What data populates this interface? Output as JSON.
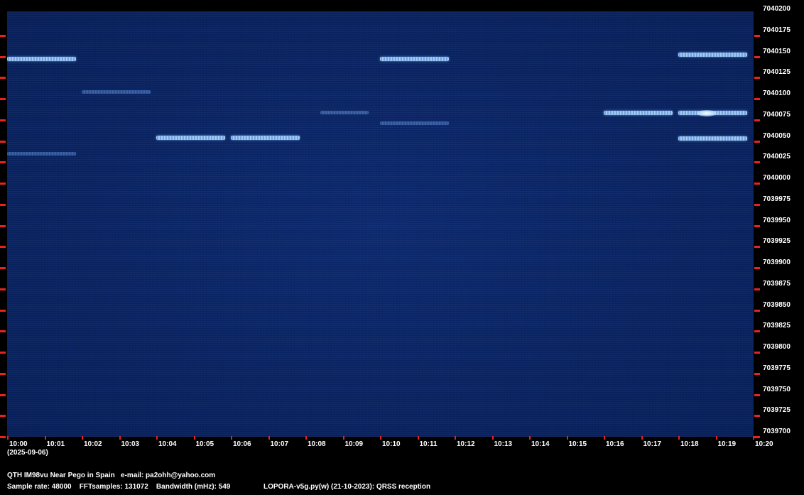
{
  "colors": {
    "background": "#000000",
    "waterfall": "#0a2463",
    "tick_marks": "#e8231d",
    "text": "#ffffff",
    "signal": "#bfe3ff"
  },
  "frequency_axis": {
    "labels": [
      "7040200",
      "7040175",
      "7040150",
      "7040125",
      "7040100",
      "7040075",
      "7040050",
      "7040025",
      "7040000",
      "7039975",
      "7039950",
      "7039925",
      "7039900",
      "7039875",
      "7039850",
      "7039825",
      "7039800",
      "7039775",
      "7039750",
      "7039725",
      "7039700"
    ]
  },
  "time_axis": {
    "labels": [
      "10:00",
      "10:01",
      "10:02",
      "10:03",
      "10:04",
      "10:05",
      "10:06",
      "10:07",
      "10:08",
      "10:09",
      "10:10",
      "10:11",
      "10:12",
      "10:13",
      "10:14",
      "10:15",
      "10:16",
      "10:17",
      "10:18",
      "10:19",
      "10:20"
    ],
    "date": "(2025-09-06)"
  },
  "signals": [
    {
      "t_start": 0.0,
      "t_end": 1.85,
      "freq": 7040146,
      "strength": "strong"
    },
    {
      "t_start": 2.0,
      "t_end": 3.85,
      "freq": 7040107,
      "strength": "faint"
    },
    {
      "t_start": 0.0,
      "t_end": 1.85,
      "freq": 7040034,
      "strength": "faint"
    },
    {
      "t_start": 4.0,
      "t_end": 5.85,
      "freq": 7040053,
      "strength": "strong"
    },
    {
      "t_start": 6.0,
      "t_end": 7.85,
      "freq": 7040053,
      "strength": "strong"
    },
    {
      "t_start": 8.4,
      "t_end": 9.7,
      "freq": 7040082,
      "strength": "faint"
    },
    {
      "t_start": 10.0,
      "t_end": 11.85,
      "freq": 7040146,
      "strength": "strong"
    },
    {
      "t_start": 10.0,
      "t_end": 11.85,
      "freq": 7040070,
      "strength": "faint"
    },
    {
      "t_start": 16.0,
      "t_end": 17.85,
      "freq": 7040082,
      "strength": "strong"
    },
    {
      "t_start": 18.0,
      "t_end": 19.85,
      "freq": 7040151,
      "strength": "strong"
    },
    {
      "t_start": 18.0,
      "t_end": 19.85,
      "freq": 7040082,
      "strength": "strong"
    },
    {
      "t_start": 18.0,
      "t_end": 19.85,
      "freq": 7040052,
      "strength": "strong"
    }
  ],
  "footer": {
    "line1": "QTH IM98vu Near Pego in Spain   e-mail: pa2ohh@yahoo.com",
    "line2_params": "Sample rate: 48000    FFTsamples: 131072    Bandwidth (mHz): 549",
    "line2_program": "LOPORA-v5g.py(w) (21-10-2023): QRSS reception"
  }
}
